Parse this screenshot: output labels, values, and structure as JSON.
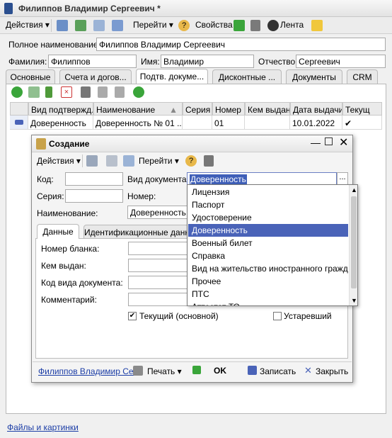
{
  "window": {
    "title": "Филиппов Владимир Сергеевич *"
  },
  "toolbar": {
    "actions": "Действия",
    "goto": "Перейти",
    "properties": "Свойства",
    "feed": "Лента"
  },
  "form": {
    "full_name_label": "Полное наименование:",
    "full_name_value": "Филиппов Владимир Сергеевич",
    "last_name_label": "Фамилия:",
    "last_name_value": "Филиппов",
    "first_name_label": "Имя:",
    "first_name_value": "Владимир",
    "patronymic_label": "Отчество:",
    "patronymic_value": "Сергеевич"
  },
  "tabs": [
    "Основные",
    "Счета и догов...",
    "Подтв. докуме...",
    "Дисконтные ...",
    "Документы",
    "CRM"
  ],
  "grid": {
    "columns": [
      "Вид подтвержд...",
      "Наименование",
      "Серия",
      "Номер",
      "Кем выдан",
      "Дата выдачи",
      "Текущ"
    ],
    "row": [
      "Доверенность",
      "Доверенность  № 01 ...",
      "",
      "01",
      "",
      "10.01.2022",
      "✔"
    ]
  },
  "dialog": {
    "title": "Создание",
    "actions": "Действия",
    "goto": "Перейти",
    "code_label": "Код:",
    "doc_type_label": "Вид документа:",
    "doc_type_value": "Доверенность",
    "series_label": "Серия:",
    "number_label": "Номер:",
    "name_label": "Наименование:",
    "name_value": "Доверенность",
    "tab_data": "Данные",
    "tab_ident": "Идентификационные данн",
    "form_number_label": "Номер бланка:",
    "issued_by_label": "Кем выдан:",
    "doc_kind_code_label": "Код вида документа:",
    "comment_label": "Комментарий:",
    "current_label": "Текущий (основной)",
    "obsolete_label": "Устаревший",
    "footer_link": "Филиппов Владимир Се...",
    "print": "Печать",
    "ok": "OK",
    "save_close": "Записать",
    "close": "Закрыть"
  },
  "dropdown": {
    "items": [
      "Лицензия",
      "Паспорт",
      "Удостоверение",
      "Доверенность",
      "Военный билет",
      "Справка",
      "Вид на жительство иностранного гражда...",
      "Прочее",
      "ПТС",
      "Аттестат ТО"
    ],
    "selected_index": 3
  },
  "footer": {
    "files_link": "Файлы и картинки"
  },
  "colors": {
    "selection": "#4a63b8",
    "link": "#1b3da6",
    "green": "#3aa53a"
  }
}
